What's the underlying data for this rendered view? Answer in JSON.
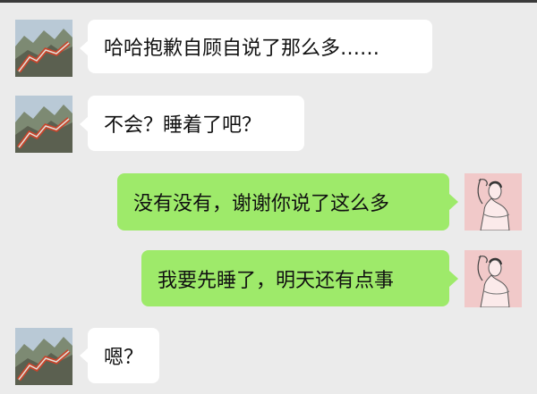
{
  "messages": [
    {
      "side": "in",
      "text": "哈哈抱歉自顾自说了那么多……",
      "avatar": "mountain-wall-icon"
    },
    {
      "side": "in",
      "text": "不会？睡着了吧？",
      "avatar": "mountain-wall-icon"
    },
    {
      "side": "out",
      "text": "没有没有，谢谢你说了这么多",
      "avatar": "woman-sketch-icon"
    },
    {
      "side": "out",
      "text": "我要先睡了，明天还有点事",
      "avatar": "woman-sketch-icon"
    },
    {
      "side": "in",
      "text": "嗯？",
      "avatar": "mountain-wall-icon"
    }
  ],
  "colors": {
    "background": "#ebebeb",
    "incoming_bubble": "#ffffff",
    "outgoing_bubble": "#9eea6a"
  }
}
